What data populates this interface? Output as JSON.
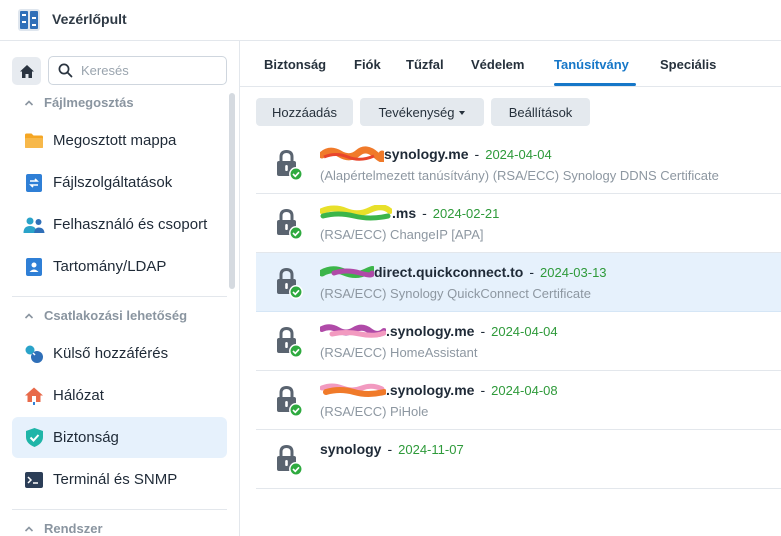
{
  "app": {
    "title": "Vezérlőpult"
  },
  "search": {
    "placeholder": "Keresés"
  },
  "sidebar": {
    "sections": [
      {
        "label": "Fájlmegosztás"
      },
      {
        "label": "Csatlakozási lehetőség"
      },
      {
        "label": "Rendszer"
      }
    ],
    "items": [
      {
        "label": "Megosztott mappa",
        "icon": "folder-icon"
      },
      {
        "label": "Fájlszolgáltatások",
        "icon": "file-services-icon"
      },
      {
        "label": "Felhasználó és csoport",
        "icon": "users-icon"
      },
      {
        "label": "Tartomány/LDAP",
        "icon": "domain-icon"
      },
      {
        "label": "Külső hozzáférés",
        "icon": "external-access-icon"
      },
      {
        "label": "Hálózat",
        "icon": "network-home-icon"
      },
      {
        "label": "Biztonság",
        "icon": "shield-check-icon",
        "active": true
      },
      {
        "label": "Terminál és SNMP",
        "icon": "terminal-icon"
      }
    ]
  },
  "tabs": [
    {
      "label": "Biztonság"
    },
    {
      "label": "Fiók"
    },
    {
      "label": "Tűzfal"
    },
    {
      "label": "Védelem"
    },
    {
      "label": "Tanúsítvány",
      "active": true
    },
    {
      "label": "Speciális"
    }
  ],
  "toolbar": {
    "add_label": "Hozzáadás",
    "action_label": "Tevékenység",
    "settings_label": "Beállítások"
  },
  "certificates": [
    {
      "name": "synology.me",
      "date": "2024-04-04",
      "description": "(Alapértelmezett tanúsítvány) (RSA/ECC) Synology DDNS Certificate",
      "redaction_colors": [
        "#f07a2a",
        "#e8452c"
      ]
    },
    {
      "name": ".ms",
      "date": "2024-02-21",
      "description": "(RSA/ECC) ChangeIP [APA]",
      "redaction_colors": [
        "#e8e02a",
        "#3cb54a"
      ]
    },
    {
      "name": "direct.quickconnect.to",
      "date": "2024-03-13",
      "description": "(RSA/ECC) Synology QuickConnect Certificate",
      "selected": true,
      "redaction_colors": [
        "#3cb54a",
        "#b04aa8"
      ]
    },
    {
      "name": ".synology.me",
      "date": "2024-04-04",
      "description": "(RSA/ECC) HomeAssistant",
      "redaction_colors": [
        "#b04aa8",
        "#f29ac0"
      ]
    },
    {
      "name": ".synology.me",
      "date": "2024-04-08",
      "description": "(RSA/ECC) PiHole",
      "redaction_colors": [
        "#f29ac0",
        "#f07a2a"
      ]
    },
    {
      "name": "synology",
      "date": "2024-11-07",
      "description": ""
    }
  ],
  "colors": {
    "accent": "#1677c8",
    "date_green": "#2e9a3a",
    "selected_row": "#e6f1fc"
  }
}
